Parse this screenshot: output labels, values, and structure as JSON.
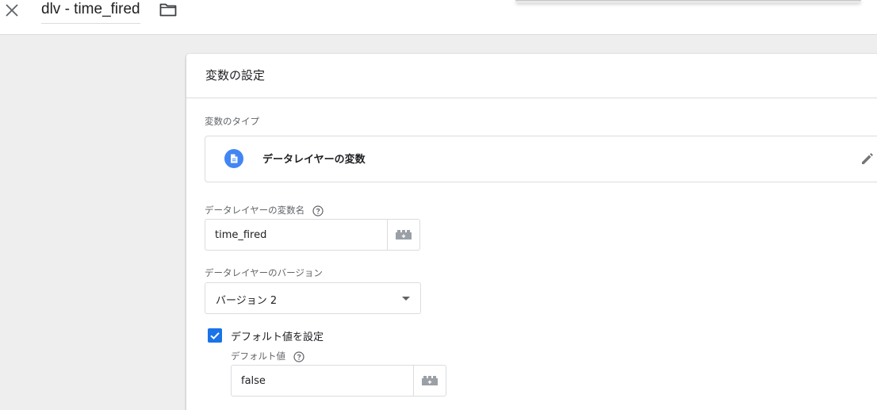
{
  "header": {
    "title": "dlv - time_fired",
    "close_icon": "close-icon",
    "folder_icon": "folder-icon"
  },
  "panel": {
    "title": "変数の設定",
    "type_section_label": "変数のタイプ",
    "type_name": "データレイヤーの変数",
    "type_icon": "document-icon",
    "edit_icon": "pencil-icon"
  },
  "fields": {
    "var_name_label": "データレイヤーの変数名",
    "var_name_value": "time_fired",
    "version_label": "データレイヤーのバージョン",
    "version_value": "バージョン 2",
    "default_checkbox_label": "デフォルト値を設定",
    "default_checked": true,
    "default_value_label": "デフォルト値",
    "default_value": "false"
  },
  "colors": {
    "accent": "#1a73e8",
    "type_icon_bg": "#4285f4",
    "border": "#dadce0",
    "background": "#eeeeee"
  }
}
